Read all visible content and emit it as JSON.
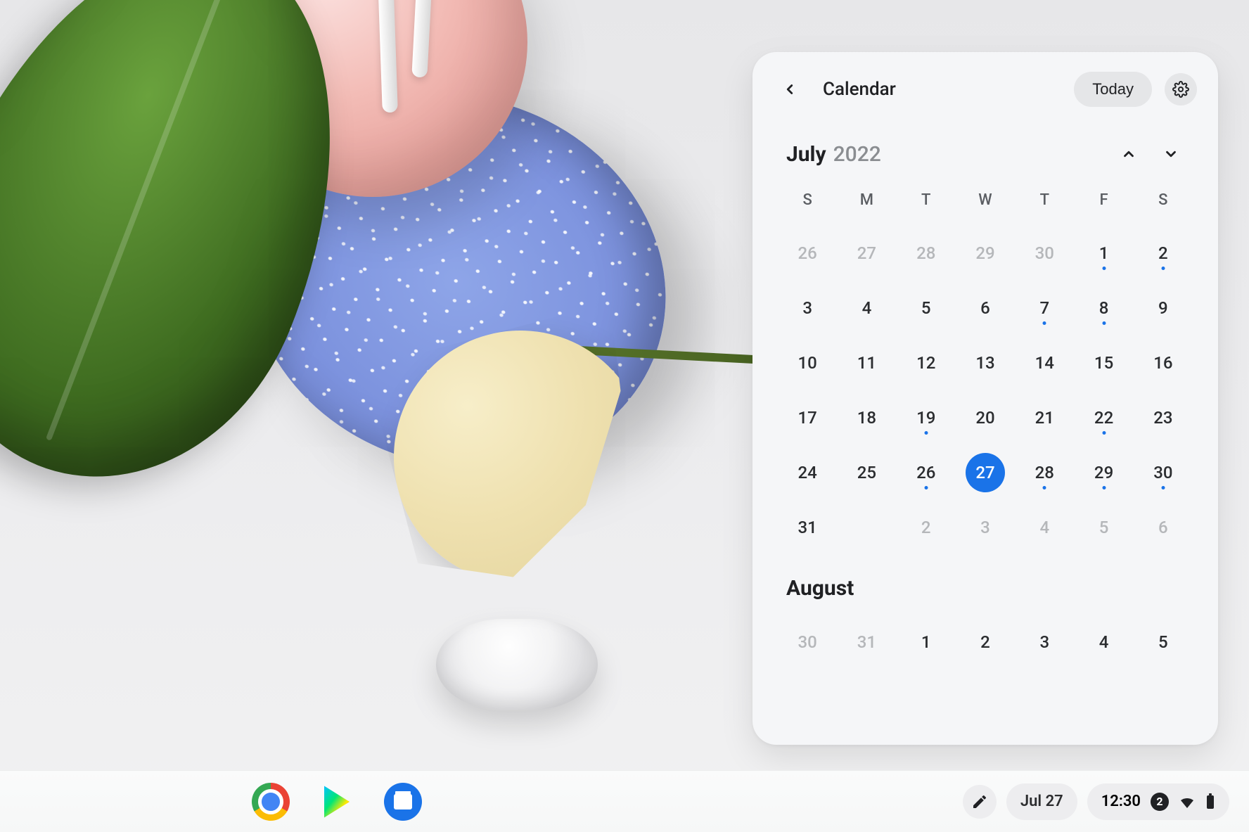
{
  "calendar": {
    "title": "Calendar",
    "today_label": "Today",
    "month": "July",
    "year": "2022",
    "weekdays": [
      "S",
      "M",
      "T",
      "W",
      "T",
      "F",
      "S"
    ],
    "days": [
      {
        "n": "26",
        "out": true
      },
      {
        "n": "27",
        "out": true
      },
      {
        "n": "28",
        "out": true
      },
      {
        "n": "29",
        "out": true
      },
      {
        "n": "30",
        "out": true
      },
      {
        "n": "1",
        "dot": true
      },
      {
        "n": "2",
        "dot": true
      },
      {
        "n": "3"
      },
      {
        "n": "4"
      },
      {
        "n": "5"
      },
      {
        "n": "6"
      },
      {
        "n": "7",
        "dot": true
      },
      {
        "n": "8",
        "dot": true
      },
      {
        "n": "9"
      },
      {
        "n": "10"
      },
      {
        "n": "11"
      },
      {
        "n": "12"
      },
      {
        "n": "13"
      },
      {
        "n": "14"
      },
      {
        "n": "15"
      },
      {
        "n": "16"
      },
      {
        "n": "17"
      },
      {
        "n": "18"
      },
      {
        "n": "19",
        "dot": true
      },
      {
        "n": "20"
      },
      {
        "n": "21"
      },
      {
        "n": "22",
        "dot": true
      },
      {
        "n": "23"
      },
      {
        "n": "24"
      },
      {
        "n": "25"
      },
      {
        "n": "26",
        "dot": true
      },
      {
        "n": "27",
        "today": true
      },
      {
        "n": "28",
        "dot": true
      },
      {
        "n": "29",
        "dot": true
      },
      {
        "n": "30",
        "dot": true
      },
      {
        "n": "31"
      },
      {
        "n": "2",
        "out": true
      },
      {
        "n": "3",
        "out": true
      },
      {
        "n": "4",
        "out": true
      },
      {
        "n": "5",
        "out": true
      },
      {
        "n": "6",
        "out": true
      }
    ],
    "days_row6_start_blank": false,
    "next_month": "August",
    "next_days": [
      {
        "n": "30",
        "out": true
      },
      {
        "n": "31",
        "out": true
      },
      {
        "n": "1"
      },
      {
        "n": "2"
      },
      {
        "n": "3"
      },
      {
        "n": "4"
      },
      {
        "n": "5"
      }
    ]
  },
  "shelf": {
    "date_label": "Jul 27",
    "time": "12:30",
    "notif_count": "2"
  }
}
